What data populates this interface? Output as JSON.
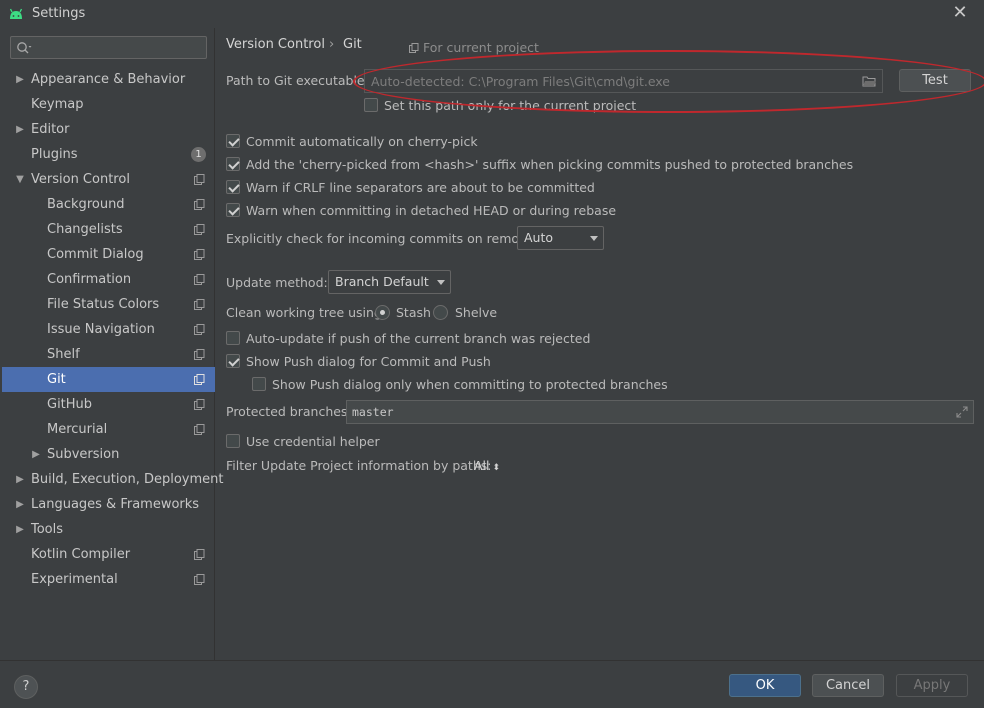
{
  "window": {
    "title": "Settings"
  },
  "sidebar": {
    "search_placeholder": "",
    "items": [
      {
        "label": "Appearance & Behavior",
        "has_arrow": true,
        "expanded": false
      },
      {
        "label": "Keymap"
      },
      {
        "label": "Editor",
        "has_arrow": true,
        "expanded": false
      },
      {
        "label": "Plugins",
        "badge": "1"
      },
      {
        "label": "Version Control",
        "has_arrow": true,
        "expanded": true
      },
      {
        "label": "Background"
      },
      {
        "label": "Changelists"
      },
      {
        "label": "Commit Dialog"
      },
      {
        "label": "Confirmation"
      },
      {
        "label": "File Status Colors"
      },
      {
        "label": "Issue Navigation"
      },
      {
        "label": "Shelf"
      },
      {
        "label": "Git",
        "selected": true
      },
      {
        "label": "GitHub"
      },
      {
        "label": "Mercurial"
      },
      {
        "label": "Subversion",
        "has_arrow": true,
        "expanded": false
      },
      {
        "label": "Build, Execution, Deployment",
        "has_arrow": true,
        "expanded": false
      },
      {
        "label": "Languages & Frameworks",
        "has_arrow": true,
        "expanded": false
      },
      {
        "label": "Tools",
        "has_arrow": true,
        "expanded": false
      },
      {
        "label": "Kotlin Compiler"
      },
      {
        "label": "Experimental"
      }
    ]
  },
  "breadcrumb": {
    "parent": "Version Control",
    "separator": "›",
    "current": "Git",
    "scope": "For current project"
  },
  "git": {
    "path_label": "Path to Git executable:",
    "path_placeholder": "Auto-detected: C:\\Program Files\\Git\\cmd\\git.exe",
    "test_button": "Test",
    "path_only_current": {
      "label": "Set this path only for the current project",
      "checked": false
    },
    "options": [
      {
        "label": "Commit automatically on cherry-pick",
        "checked": true
      },
      {
        "label": "Add the 'cherry-picked from <hash>' suffix when picking commits pushed to protected branches",
        "checked": true
      },
      {
        "label": "Warn if CRLF line separators are about to be committed",
        "checked": true
      },
      {
        "label": "Warn when committing in detached HEAD or during rebase",
        "checked": true
      }
    ],
    "incoming_label": "Explicitly check for incoming commits on remotes:",
    "incoming_value": "Auto",
    "update_method_label": "Update method:",
    "update_method_value": "Branch Default",
    "clean_tree_label": "Clean working tree using:",
    "stash_label": "Stash",
    "shelve_label": "Shelve",
    "clean_tree_selected": "Stash",
    "auto_update": {
      "label": "Auto-update if push of the current branch was rejected",
      "checked": false
    },
    "show_push": {
      "label": "Show Push dialog for Commit and Push",
      "checked": true
    },
    "show_push_protected": {
      "label": "Show Push dialog only when committing to protected branches",
      "checked": false
    },
    "protected_label": "Protected branches:",
    "protected_value": "master",
    "credential_helper": {
      "label": "Use credential helper",
      "checked": false
    },
    "filter_label": "Filter Update Project information by paths:",
    "filter_value": "All"
  },
  "footer": {
    "help": "?",
    "ok": "OK",
    "cancel": "Cancel",
    "apply": "Apply"
  },
  "colors": {
    "selection": "#4b6eaf",
    "annotation": "#c0282d",
    "ok_button": "#365880"
  }
}
